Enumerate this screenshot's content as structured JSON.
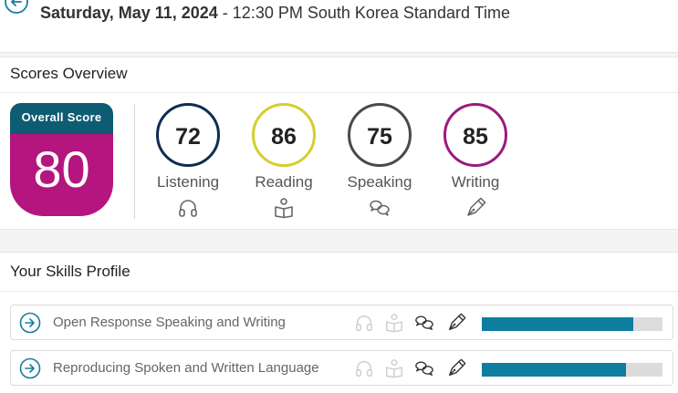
{
  "header": {
    "date_bold": "Saturday, May 11, 2024",
    "date_rest": " - 12:30 PM South Korea Standard Time"
  },
  "scores": {
    "title": "Scores Overview",
    "overall_label": "Overall Score",
    "overall_value": "80",
    "overall_colors": {
      "header": "#0e5c72",
      "body": "#b4157f"
    },
    "skills": [
      {
        "name": "Listening",
        "value": "72",
        "color": "#0f2d52",
        "icon": "headphones-icon"
      },
      {
        "name": "Reading",
        "value": "86",
        "color": "#d4cf2e",
        "icon": "reader-icon"
      },
      {
        "name": "Speaking",
        "value": "75",
        "color": "#4a4a4a",
        "icon": "speech-bubbles-icon"
      },
      {
        "name": "Writing",
        "value": "85",
        "color": "#9a1b7e",
        "icon": "pen-icon"
      }
    ]
  },
  "profile": {
    "title": "Your Skills Profile",
    "bar_color": "#0e7ea0",
    "rows": [
      {
        "label": "Open Response Speaking and Writing",
        "active_skills": [
          "speaking",
          "writing"
        ],
        "score_fraction": 0.84
      },
      {
        "label": "Reproducing Spoken and Written Language",
        "active_skills": [
          "speaking",
          "writing"
        ],
        "score_fraction": 0.8
      }
    ]
  }
}
